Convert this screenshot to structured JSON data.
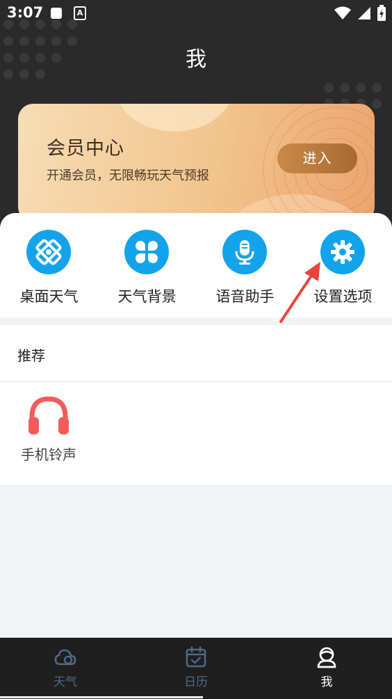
{
  "status_bar": {
    "time": "3:07",
    "a_icon_letter": "A"
  },
  "header": {
    "title": "我"
  },
  "vip": {
    "title": "会员中心",
    "subtitle": "开通会员，无限畅玩天气预报",
    "enter_button": "进入"
  },
  "actions": [
    {
      "label": "桌面天气",
      "icon": "desktop-widget-icon"
    },
    {
      "label": "天气背景",
      "icon": "clover-icon"
    },
    {
      "label": "语音助手",
      "icon": "microphone-icon"
    },
    {
      "label": "设置选项",
      "icon": "gear-icon"
    }
  ],
  "recommend": {
    "title": "推荐",
    "items": [
      {
        "label": "手机铃声",
        "icon": "headphones-icon",
        "color": "#f35b5b"
      }
    ]
  },
  "tabs": [
    {
      "label": "天气",
      "icon": "cloud-icon",
      "active": false
    },
    {
      "label": "日历",
      "icon": "calendar-icon",
      "active": false
    },
    {
      "label": "我",
      "icon": "user-icon",
      "active": true
    }
  ],
  "colors": {
    "accent_blue": "#13a3ea",
    "tab_inactive": "#4e6a86",
    "tab_active": "#ffffff",
    "header_bg": "#2a2a2a",
    "annotation_red": "#e8453c"
  }
}
